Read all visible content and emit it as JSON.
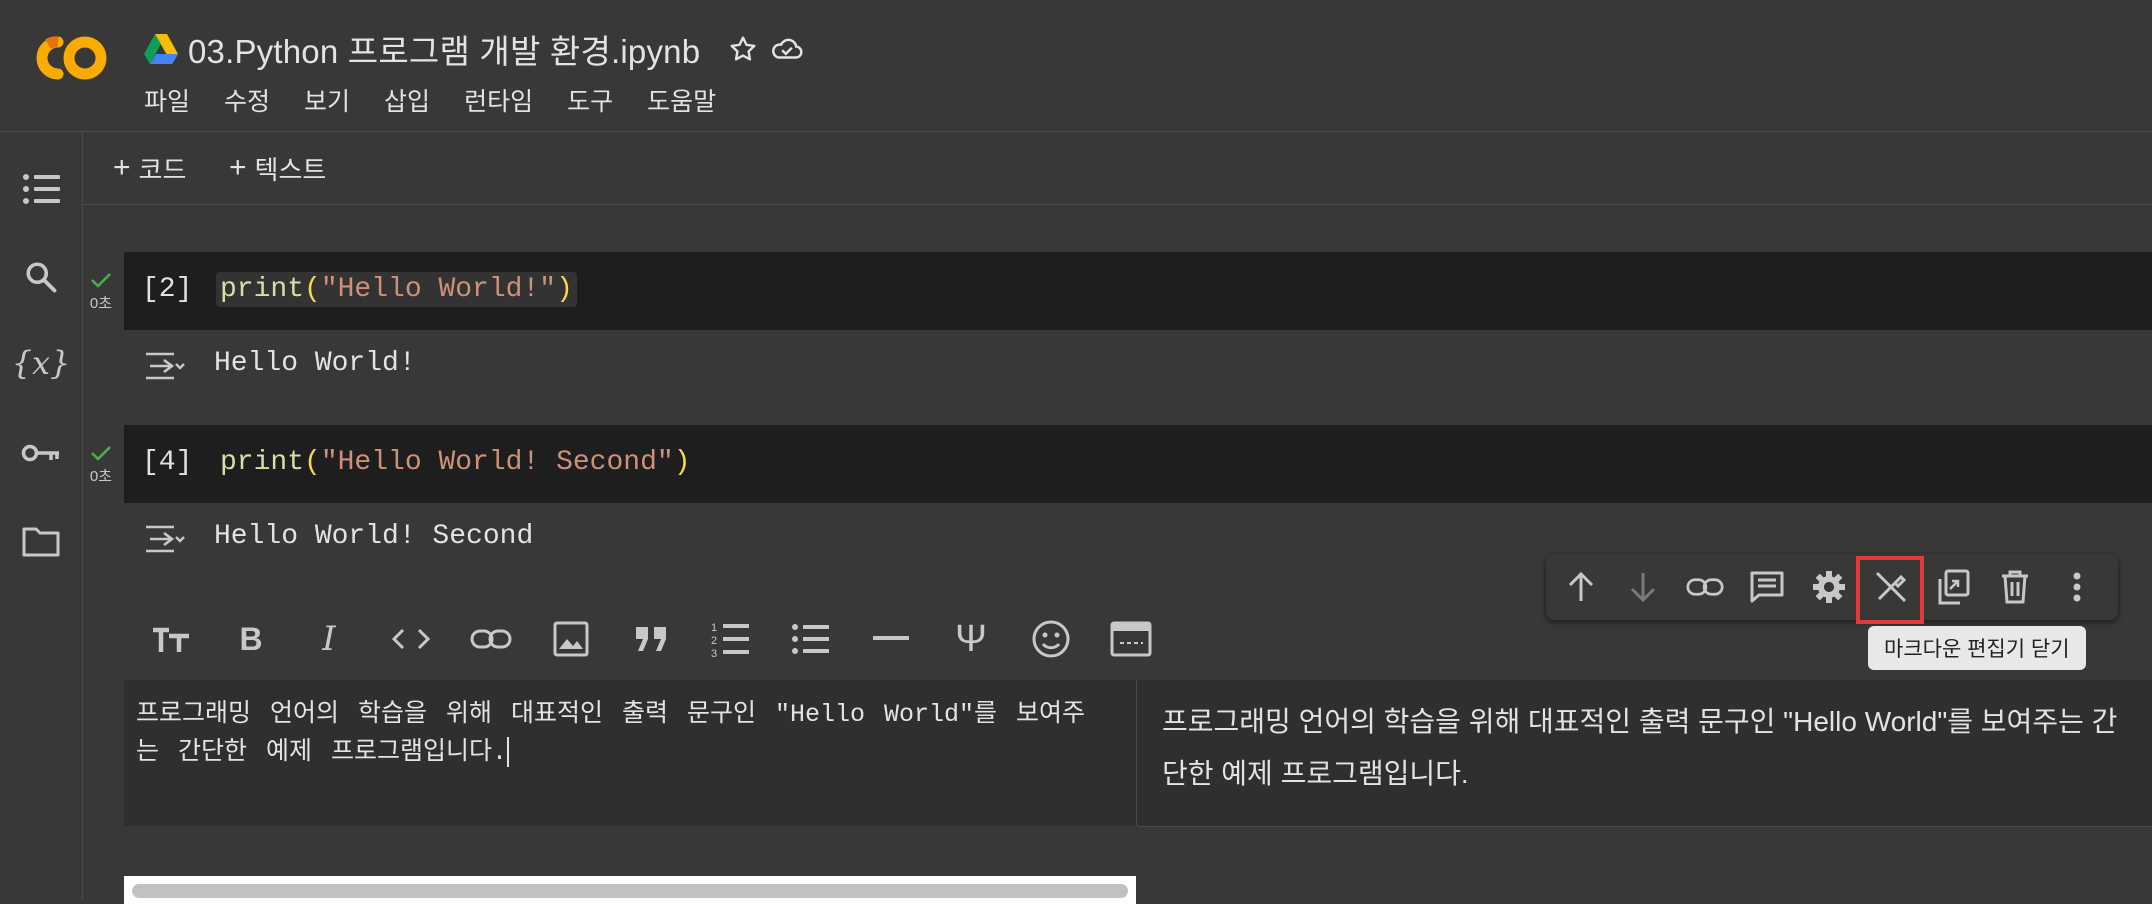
{
  "app": {
    "logo_text": "CO",
    "title": "03.Python 프로그램 개발 환경.ipynb",
    "menu": [
      "파일",
      "수정",
      "보기",
      "삽입",
      "런타임",
      "도구",
      "도움말"
    ],
    "title_icons": [
      "star-icon",
      "cloud-saved-icon"
    ]
  },
  "sidebar": {
    "items": [
      "table-of-contents-icon",
      "search-icon",
      "variables-icon",
      "secrets-key-icon",
      "files-folder-icon"
    ],
    "variables_glyph": "{x}"
  },
  "toolbar": {
    "add_code": "코드",
    "add_text": "텍스트",
    "plus": "+"
  },
  "cells": [
    {
      "exec_label": "[2]",
      "status": "0초",
      "code": {
        "fn": "print",
        "open": "(",
        "str": "\"Hello World!\"",
        "close": ")"
      },
      "output": "Hello World!"
    },
    {
      "exec_label": "[4]",
      "status": "0초",
      "code": {
        "fn": "print",
        "open": "(",
        "str": "\"Hello World! Second\"",
        "close": ")"
      },
      "output": "Hello World! Second"
    }
  ],
  "markdown_cell": {
    "editor_text": "프로그래밍 언어의 학습을 위해 대표적인 출력 문구인 \"Hello World\"를 보여주는 간단한 예제 프로그램입니다.",
    "preview_text": "프로그래밍 언어의 학습을 위해 대표적인 출력 문구인 \"Hello World\"를 보여주는 간단한 예제 프로그램입니다.",
    "toolbar_icons": [
      "text-size-icon",
      "bold-icon",
      "italic-icon",
      "code-icon",
      "link-icon",
      "image-icon",
      "quote-icon",
      "numbered-list-icon",
      "bulleted-list-icon",
      "horizontal-rule-icon",
      "latex-psi-icon",
      "emoji-icon",
      "tab-layout-icon"
    ]
  },
  "cell_actions": {
    "icons": [
      "move-up-icon",
      "move-down-icon",
      "link-icon",
      "comment-icon",
      "settings-icon",
      "close-markdown-editor-icon",
      "mirror-cell-icon",
      "delete-icon",
      "more-icon"
    ],
    "tooltip": "마크다운 편집기 닫기",
    "highlight_color": "#e53935"
  },
  "colors": {
    "background": "#383838",
    "code_bg": "#1e1e1e",
    "logo_orange": "#f9ab00",
    "check_green": "#4caf50",
    "string": "#ce9178",
    "function": "#dcdcaa",
    "paren": "#f9d849"
  }
}
